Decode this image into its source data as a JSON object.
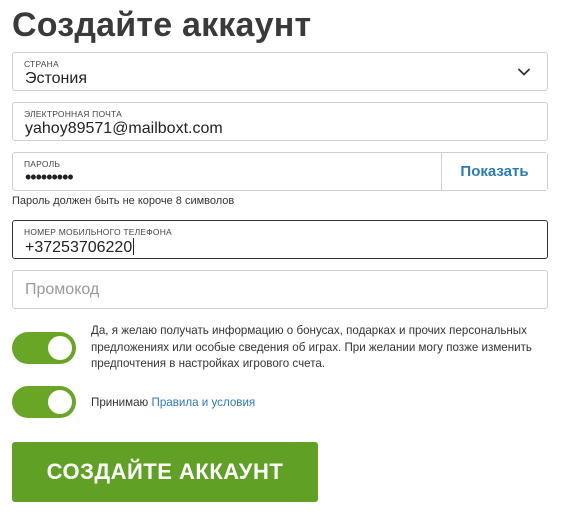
{
  "form": {
    "title": "Создайте аккаунт",
    "country": {
      "label": "СТРАНА",
      "value": "Эстония"
    },
    "email": {
      "label": "ЭЛЕКТРОННАЯ ПОЧТА",
      "value": "yahoy89571@mailboxt.com"
    },
    "password": {
      "label": "ПАРОЛЬ",
      "value_masked": "•••••••••",
      "show_label": "Показать",
      "hint": "Пароль должен быть не короче 8 символов"
    },
    "phone": {
      "label": "НОМЕР МОБИЛЬНОГО ТЕЛЕФОНА",
      "value": "+37253706220"
    },
    "promo": {
      "placeholder": "Промокод"
    },
    "consent": {
      "checked": true,
      "text": "Да, я желаю получать информацию о бонусах, подарках и прочих персональных предложениях или особые сведения об играх. При желании могу позже изменить предпочтения в настройках игрового счета."
    },
    "terms": {
      "checked": true,
      "prefix": "Принимаю",
      "link": "Правила и условия"
    },
    "submit_label": "СОЗДАЙТЕ АККАУНТ"
  },
  "colors": {
    "accent_green": "#60a024",
    "toggle_green": "#6aa626",
    "link_blue": "#2a7ab8",
    "title_text": "#3a3a3a"
  },
  "icons": [
    "chevron-down-icon"
  ]
}
